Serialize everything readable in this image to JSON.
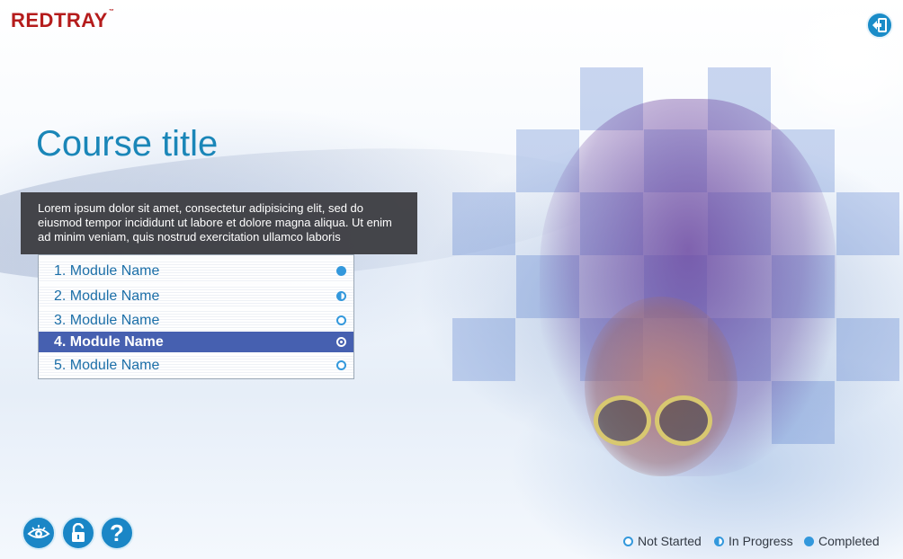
{
  "brand": {
    "logo_text": "REDTRAY",
    "trademark": "™"
  },
  "header": {
    "exit_icon": "exit-icon"
  },
  "course": {
    "title": "Course title",
    "description": "Lorem ipsum dolor sit amet, consectetur adipisicing elit, sed do eiusmod tempor incididunt ut labore et dolore magna aliqua. Ut enim ad minim veniam, quis nostrud exercitation ullamco laboris"
  },
  "modules": [
    {
      "label": "1. Module Name",
      "status": "completed"
    },
    {
      "label": "2. Module Name",
      "status": "in-progress"
    },
    {
      "label": "3. Module Name",
      "status": "not-started"
    },
    {
      "label": "4. Module Name",
      "status": "not-started",
      "selected": true
    },
    {
      "label": "5. Module Name",
      "status": "not-started"
    }
  ],
  "toolbar": {
    "view_icon": "eye-icon",
    "lock_icon": "lock-icon",
    "help_icon": "help-icon",
    "help_glyph": "?"
  },
  "legend": {
    "not_started": "Not Started",
    "in_progress": "In Progress",
    "completed": "Completed"
  },
  "colors": {
    "brand_red": "#b51c1c",
    "accent_blue": "#1a86b8",
    "selected_row": "#4660b0",
    "status_blue": "#3398dc"
  }
}
